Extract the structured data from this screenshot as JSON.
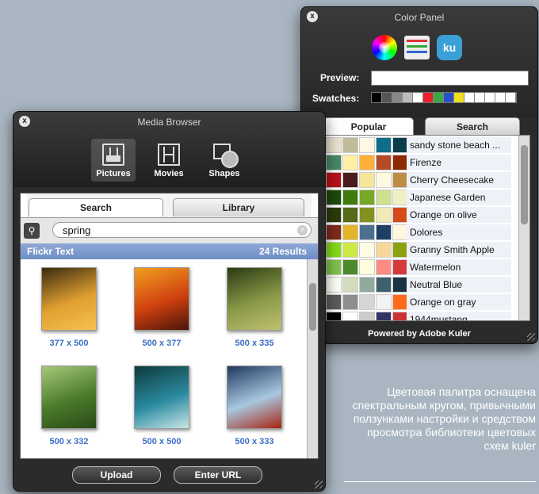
{
  "color_panel": {
    "title": "Color Panel",
    "close_label": "x",
    "kuler_icon_label": "ku",
    "preview_label": "Preview:",
    "swatches_label": "Swatches:",
    "swatches": [
      "#000000",
      "#555555",
      "#888888",
      "#bbbbbb",
      "#ffffff",
      "#e8202a",
      "#3aa845",
      "#2b4fc4",
      "#f2de1a",
      "#ffffff",
      "#ffffff",
      "#ffffff",
      "#ffffff",
      "#ffffff"
    ],
    "tabs": [
      "Popular",
      "Search"
    ],
    "themes": [
      {
        "name": "sandy stone beach ...",
        "colors": [
          "#e8e2cf",
          "#c2bb9a",
          "#fdf8e4",
          "#0e6e8c",
          "#0b3d4a"
        ]
      },
      {
        "name": "Firenze",
        "colors": [
          "#468966",
          "#fff0a5",
          "#ffb03b",
          "#b64926",
          "#8e2800"
        ]
      },
      {
        "name": "Cherry Cheesecake",
        "colors": [
          "#b9121b",
          "#4c1b1b",
          "#f6e497",
          "#fcfae1",
          "#bd8d46"
        ]
      },
      {
        "name": "Japanese Garden",
        "colors": [
          "#1d4a0b",
          "#3f7b0e",
          "#75a825",
          "#cce090",
          "#f1f0c5"
        ]
      },
      {
        "name": "Orange on olive",
        "colors": [
          "#2c3a0b",
          "#556b1b",
          "#819220",
          "#f1e9b8",
          "#d44a18"
        ]
      },
      {
        "name": "Dolores",
        "colors": [
          "#7f2a1b",
          "#e3b42a",
          "#4d6f8f",
          "#1d3f63",
          "#fff6df"
        ]
      },
      {
        "name": "Granny Smith Apple",
        "colors": [
          "#85db18",
          "#cde846",
          "#fdfbe3",
          "#f7d79a",
          "#8ba10e"
        ]
      },
      {
        "name": "Watermelon",
        "colors": [
          "#7fc14b",
          "#4c8b2b",
          "#fefedf",
          "#fc8c83",
          "#d53a3a"
        ]
      },
      {
        "name": "Neutral Blue",
        "colors": [
          "#fcfff5",
          "#d1dbbd",
          "#91aa9d",
          "#3e606f",
          "#193441"
        ]
      },
      {
        "name": "Orange on gray",
        "colors": [
          "#5c5c5c",
          "#8e8e8e",
          "#d5d5d5",
          "#f2f2f2",
          "#ff6b1a"
        ]
      },
      {
        "name": "1944mustang",
        "colors": [
          "#000000",
          "#ffffff",
          "#cccccc",
          "#333366",
          "#cc3333"
        ]
      }
    ],
    "footer": "Powered by Adobe Kuler"
  },
  "media_browser": {
    "title": "Media Browser",
    "close_label": "x",
    "tools": [
      "Pictures",
      "Movies",
      "Shapes"
    ],
    "tabs": [
      "Search",
      "Library"
    ],
    "search_value": "spring",
    "binoculars_glyph": "⚲",
    "clear_glyph": "×",
    "section_title": "Flickr Text",
    "result_count": "24 Results",
    "thumbnails": [
      {
        "label": "377 x 500",
        "colors": [
          "#3a2a10",
          "#e0a030",
          "#f6c050"
        ]
      },
      {
        "label": "500 x 377",
        "colors": [
          "#f0a020",
          "#d04010",
          "#4a1408"
        ]
      },
      {
        "label": "500 x 335",
        "colors": [
          "#2b3a12",
          "#8a9a48",
          "#c0c070"
        ]
      },
      {
        "label": "500 x 332",
        "colors": [
          "#a6c87a",
          "#4a7a2a",
          "#2a4a18"
        ]
      },
      {
        "label": "500 x 500",
        "colors": [
          "#0e3a3a",
          "#2a8aa0",
          "#c8e6e6"
        ]
      },
      {
        "label": "500 x 333",
        "colors": [
          "#203860",
          "#a8c8e0",
          "#a82410"
        ]
      }
    ],
    "buttons": [
      "Upload",
      "Enter URL"
    ]
  },
  "caption": {
    "text": "Цветовая палитра оснащена спектральным кругом, привычными ползунками настройки и средством просмотра библиотеки цветовых схем kuler"
  }
}
